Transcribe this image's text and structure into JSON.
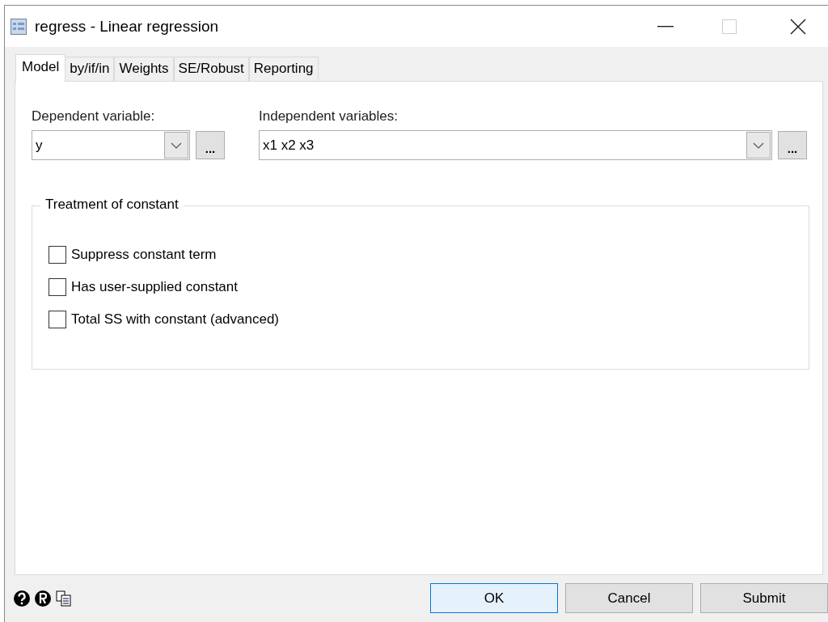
{
  "window": {
    "title": "regress - Linear regression"
  },
  "tabs": [
    {
      "label": "Model",
      "selected": true
    },
    {
      "label": "by/if/in",
      "selected": false
    },
    {
      "label": "Weights",
      "selected": false
    },
    {
      "label": "SE/Robust",
      "selected": false
    },
    {
      "label": "Reporting",
      "selected": false
    }
  ],
  "fields": [
    {
      "label": "Dependent variable:",
      "value": "y",
      "browse": "..."
    },
    {
      "label": "Independent variables:",
      "value": "x1 x2 x3",
      "browse": "..."
    }
  ],
  "constant_group": {
    "title": "Treatment of constant",
    "options": [
      {
        "label": "Suppress constant term",
        "checked": false
      },
      {
        "label": "Has user-supplied constant",
        "checked": false
      },
      {
        "label": "Total SS with constant (advanced)",
        "checked": false
      }
    ]
  },
  "buttons": [
    {
      "label": "OK",
      "default": true
    },
    {
      "label": "Cancel",
      "default": false
    },
    {
      "label": "Submit",
      "default": false
    }
  ]
}
